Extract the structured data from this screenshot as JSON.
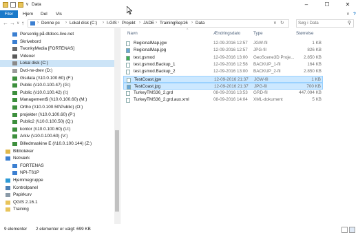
{
  "window": {
    "title": "Data"
  },
  "ribbon": {
    "tabs": [
      "Filer",
      "Hjem",
      "Del",
      "Vis"
    ]
  },
  "address": {
    "crumbs": [
      "Denne pc",
      "Lokal disk (C:)",
      "I-GIS",
      "Projekt",
      "JADE",
      "TrainingSep16",
      "Data"
    ],
    "search_placeholder": "Søg i Data"
  },
  "sidebar": {
    "items": [
      {
        "label": "Personlig på dtdocs.live.net",
        "icon": "onedrive-icon"
      },
      {
        "label": "Skrivebord",
        "icon": "desktop-icon"
      },
      {
        "label": "TwonkyMedia [FORTENAS]",
        "icon": "media-icon"
      },
      {
        "label": "Videoer",
        "icon": "video-icon"
      },
      {
        "label": "Lokal disk (C:)",
        "icon": "drive-icon",
        "selected": true
      },
      {
        "label": "Dvd-rw-drev (D:)",
        "icon": "dvd-icon"
      },
      {
        "label": "Gisdata (\\\\10.0.100.60) (F:)",
        "icon": "network-drive-icon"
      },
      {
        "label": "Public (\\\\10.0.100.47) (G:)",
        "icon": "network-drive-icon"
      },
      {
        "label": "Public (\\\\10.0.100.42) (I:)",
        "icon": "network-drive-icon"
      },
      {
        "label": "Management$ (\\\\10.0.100.60) (M:)",
        "icon": "network-drive-icon"
      },
      {
        "label": "Ortho (\\\\10.0.100.50\\Public) (O:)",
        "icon": "network-drive-icon"
      },
      {
        "label": "projekter (\\\\10.0.100.60) (P:)",
        "icon": "network-drive-icon"
      },
      {
        "label": "Public2 (\\\\10.0.100.50) (Q:)",
        "icon": "network-drive-icon"
      },
      {
        "label": "kontor (\\\\10.0.100.60) (U:)",
        "icon": "network-drive-icon"
      },
      {
        "label": "Arkiv (\\\\10.0.100.60) (V:)",
        "icon": "network-drive-icon"
      },
      {
        "label": "Billedmaskine E (\\\\10.0.100.144) (Z:)",
        "icon": "network-drive-icon"
      },
      {
        "label": "Biblioteker",
        "icon": "library-icon"
      },
      {
        "label": "Netværk",
        "icon": "network-icon"
      },
      {
        "label": "FORTENAS",
        "icon": "computer-icon"
      },
      {
        "label": "NPI-T61P",
        "icon": "computer-icon"
      },
      {
        "label": "Hjemmegruppe",
        "icon": "homegroup-icon"
      },
      {
        "label": "Kontrolpanel",
        "icon": "control-panel-icon"
      },
      {
        "label": "Papirkurv",
        "icon": "recycle-bin-icon"
      },
      {
        "label": "QGIS 2.16.1",
        "icon": "folder-icon"
      },
      {
        "label": "Training",
        "icon": "folder-icon"
      }
    ]
  },
  "filelist": {
    "columns": {
      "name": "Navn",
      "date": "Ændringsdato",
      "type": "Type",
      "size": "Størrelse"
    },
    "rows": [
      {
        "name": "RegionalMap.jgw",
        "date": "12-09-2016 12:57",
        "type": "JGW-fil",
        "size": "1 KB"
      },
      {
        "name": "RegionalMap.jpg",
        "date": "12-09-2016 12:57",
        "type": "JPG-fil",
        "size": "826 KB"
      },
      {
        "name": "test.gsmod",
        "date": "12-09-2016 13:00",
        "type": "GeoScene3D Proje...",
        "size": "2.850 KB"
      },
      {
        "name": "test.gsmod.Backup_1",
        "date": "12-09-2016 12:58",
        "type": "BACKUP_1-fil",
        "size": "164 KB"
      },
      {
        "name": "test.gsmod.Backup_2",
        "date": "12-09-2016 13:00",
        "type": "BACKUP_2-fil",
        "size": "2.850 KB"
      },
      {
        "name": "TestCoast.jgw",
        "date": "12-09-2016 21:37",
        "type": "JGW-fil",
        "size": "1 KB",
        "selected": true
      },
      {
        "name": "TestCoast.jpg",
        "date": "12-09-2016 21:37",
        "type": "JPG-fil",
        "size": "700 KB",
        "selected": true
      },
      {
        "name": "TurkeyTMS36_2.grd",
        "date": "08-09-2016 13:53",
        "type": "GRD-fil",
        "size": "447.094 KB"
      },
      {
        "name": "TurkeyTMS36_2.grd.aux.xml",
        "date": "08-09-2016 14:04",
        "type": "XML-dokument",
        "size": "5 KB"
      }
    ]
  },
  "status": {
    "count": "9 elementer",
    "selection": "2 elementer er valgt: 699 KB"
  },
  "colors": {
    "accent": "#1979ca",
    "selected_row": "#cce8ff",
    "sidebar_selected": "#cce4f7"
  }
}
